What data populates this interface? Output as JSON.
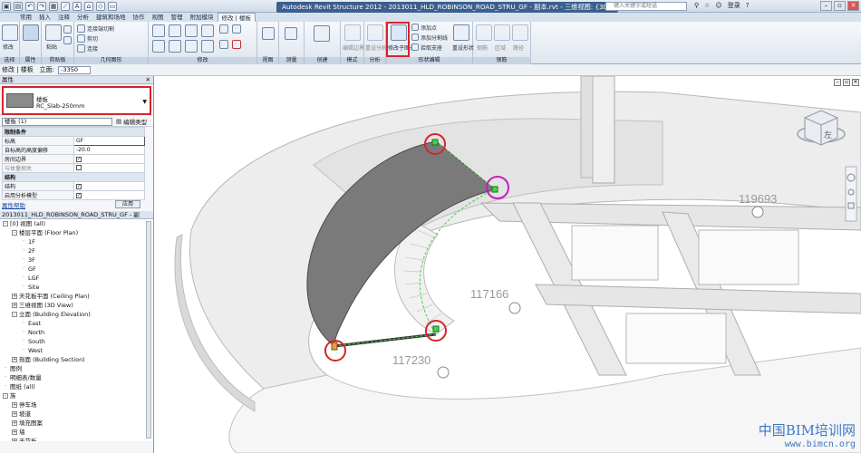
{
  "titlebar": {
    "app_title": "Autodesk Revit Structure 2012 - 2013011_HLD_ROBINSON_ROAD_STRU_GF - 副本.rvt - 三维视图: {3D}",
    "search_placeholder": "键入关键字或短语",
    "login": "登录",
    "help": "?"
  },
  "tabs": [
    "常用",
    "插入",
    "注释",
    "分析",
    "建筑和场地",
    "协作",
    "视图",
    "管理",
    "附加模块",
    "修改 | 楼板"
  ],
  "ribbon": {
    "panels": [
      {
        "label": "选择",
        "items": [
          "修改"
        ]
      },
      {
        "label": "属性",
        "items": []
      },
      {
        "label": "剪贴板",
        "items": [
          "粘贴"
        ]
      },
      {
        "label": "几何图形",
        "items": [
          "连接端切割",
          "剪切",
          "连接"
        ]
      },
      {
        "label": "修改",
        "items": []
      },
      {
        "label": "视图",
        "items": []
      },
      {
        "label": "测量",
        "items": []
      },
      {
        "label": "创建",
        "items": []
      },
      {
        "label": "模式",
        "items": [
          "编辑边界"
        ]
      },
      {
        "label": "分析",
        "items": [
          "重设分析"
        ]
      },
      {
        "label": "形状编辑",
        "items": [
          "修改子图元",
          "添加点",
          "添加分割线",
          "拾取支座",
          "重设形状"
        ]
      },
      {
        "label": "钢筋",
        "items": [
          "钢筋",
          "区域",
          "路径"
        ]
      }
    ]
  },
  "options_bar": {
    "context": "修改 | 楼板",
    "level_label": "立面:",
    "level_value": "-3350"
  },
  "properties": {
    "header": "属性",
    "type_line1": "楼板",
    "type_line2": "RC_Slab-250mm",
    "instance_selector": "楼板 (1)",
    "edit_type": "编辑类型",
    "groups": [
      {
        "name": "限制条件",
        "rows": [
          {
            "label": "标高",
            "value": "GF"
          },
          {
            "label": "自标高的高度偏移",
            "value": "-20.0"
          },
          {
            "label": "房间边界",
            "value": "✓"
          },
          {
            "label": "与体量相关",
            "value": ""
          }
        ]
      },
      {
        "name": "结构",
        "rows": [
          {
            "label": "结构",
            "value": "✓"
          },
          {
            "label": "启用分析模型",
            "value": "✓"
          }
        ]
      }
    ],
    "help_link": "属性帮助",
    "apply": "应用"
  },
  "browser": {
    "header": "2013011_HLD_ROBINSON_ROAD_STRU_GF - 副本.rvt - 项目浏览器",
    "items": [
      {
        "level": 0,
        "toggle": "-",
        "text": "[0] 视图 (all)"
      },
      {
        "level": 1,
        "toggle": "-",
        "text": "楼层平面 (Floor Plan)"
      },
      {
        "level": 2,
        "toggle": "",
        "text": "1F"
      },
      {
        "level": 2,
        "toggle": "",
        "text": "2F"
      },
      {
        "level": 2,
        "toggle": "",
        "text": "3F"
      },
      {
        "level": 2,
        "toggle": "",
        "text": "GF"
      },
      {
        "level": 2,
        "toggle": "",
        "text": "LGF"
      },
      {
        "level": 2,
        "toggle": "",
        "text": "Site"
      },
      {
        "level": 1,
        "toggle": "+",
        "text": "天花板平面 (Ceiling Plan)"
      },
      {
        "level": 1,
        "toggle": "+",
        "text": "三维视图 (3D View)"
      },
      {
        "level": 1,
        "toggle": "-",
        "text": "立面 (Building Elevation)"
      },
      {
        "level": 2,
        "toggle": "",
        "text": "East"
      },
      {
        "level": 2,
        "toggle": "",
        "text": "North"
      },
      {
        "level": 2,
        "toggle": "",
        "text": "South"
      },
      {
        "level": 2,
        "toggle": "",
        "text": "West"
      },
      {
        "level": 1,
        "toggle": "+",
        "text": "剖面 (Building Section)"
      },
      {
        "level": 0,
        "toggle": "",
        "text": "图例"
      },
      {
        "level": 0,
        "toggle": "",
        "text": "明细表/数量"
      },
      {
        "level": 0,
        "toggle": "",
        "text": "图纸 (all)"
      },
      {
        "level": 0,
        "toggle": "-",
        "text": "族"
      },
      {
        "level": 1,
        "toggle": "+",
        "text": "停车场"
      },
      {
        "level": 1,
        "toggle": "+",
        "text": "坡道"
      },
      {
        "level": 1,
        "toggle": "+",
        "text": "填充图案"
      },
      {
        "level": 1,
        "toggle": "+",
        "text": "墙"
      },
      {
        "level": 1,
        "toggle": "+",
        "text": "天花板"
      }
    ]
  },
  "viewport": {
    "labels": [
      "119693",
      "117166",
      "117230"
    ],
    "viewcube_label": "左",
    "watermark_cn": "中国BIM培训网",
    "watermark_url": "www.bimcn.org"
  },
  "colors": {
    "highlight_red": "#d8232a",
    "highlight_magenta": "#c21fc0",
    "slab_gray": "#7a7a7a",
    "vertex_green": "#4bd14b"
  }
}
